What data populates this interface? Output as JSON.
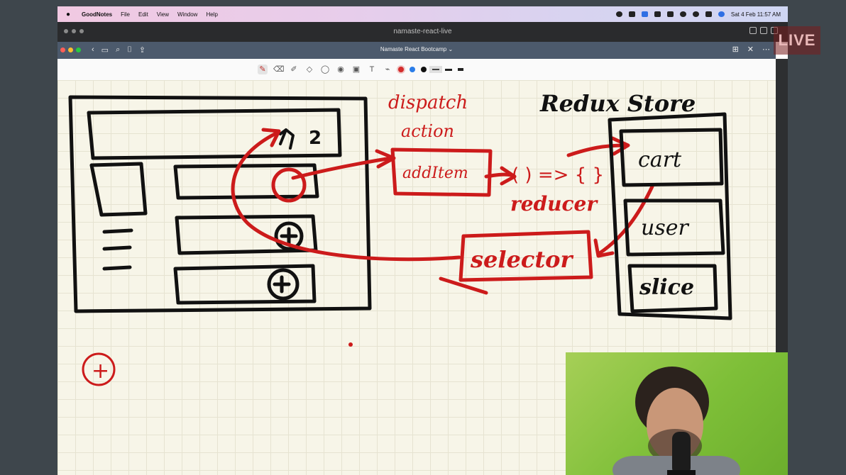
{
  "menubar": {
    "app_name": "GoodNotes",
    "items": [
      "File",
      "Edit",
      "View",
      "Window",
      "Help"
    ],
    "datetime": "Sat 4 Feb  11:57 AM"
  },
  "window": {
    "title": "namaste-react-live"
  },
  "goodnotes": {
    "document_title": "Namaste React Bootcamp ⌄"
  },
  "notes": {
    "redux_store_heading": "Redux Store",
    "dispatch_label": "dispatch",
    "action_label": "action",
    "add_item_label": "addItem",
    "reducer_fn_label": "( ) => { }",
    "reducer_label": "reducer",
    "selector_label": "selector",
    "slices": [
      "cart",
      "user",
      "slice"
    ],
    "cart_badge": "2",
    "bottom_mark": "+"
  },
  "live_badge": "LIVE",
  "colors": {
    "ink_red": "#cc1b1b",
    "ink_black": "#111111",
    "paper": "#f7f5e8"
  }
}
